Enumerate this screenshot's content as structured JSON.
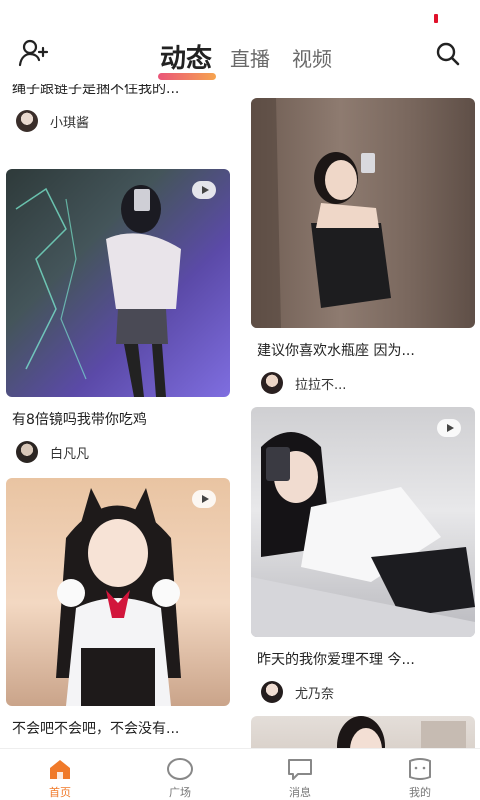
{
  "header": {
    "tabs": [
      {
        "label": "动态",
        "active": true
      },
      {
        "label": "直播",
        "active": false
      },
      {
        "label": "视频",
        "active": false
      }
    ],
    "icons": {
      "left": "add-user-icon",
      "right": "search-icon"
    }
  },
  "feed": {
    "left": [
      {
        "title": "绳子跟链子是捆不住我的...",
        "author": "小琪酱",
        "video": false
      },
      {
        "title": "有8倍镜吗我带你吃鸡",
        "author": "白凡凡",
        "video": true
      },
      {
        "title": "不会吧不会吧，不会没有...",
        "author": "",
        "video": true
      }
    ],
    "right": [
      {
        "title": "建议你喜欢水瓶座 因为...",
        "author": "拉拉不...",
        "video": false
      },
      {
        "title": "昨天的我你爱理不理 今...",
        "author": "尤乃奈",
        "video": true
      },
      {
        "title": "",
        "author": "",
        "video": false
      }
    ]
  },
  "tabbar": [
    {
      "label": "首页",
      "icon": "home-icon",
      "active": true
    },
    {
      "label": "广场",
      "icon": "circle-icon",
      "active": false
    },
    {
      "label": "消息",
      "icon": "message-icon",
      "active": false
    },
    {
      "label": "我的",
      "icon": "profile-icon",
      "active": false
    }
  ],
  "colors": {
    "accent": "#f07a2a",
    "tab_underline_start": "#e8426a",
    "tab_underline_end": "#f59a3b"
  }
}
